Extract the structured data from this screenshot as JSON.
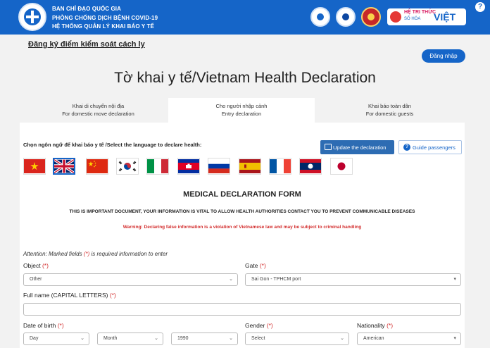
{
  "header": {
    "line1": "BAN CHỈ ĐẠO QUỐC GIA",
    "line2": "PHÒNG CHỐNG DỊCH BỆNH COVID-19",
    "line3": "HỆ THỐNG QUẢN LÝ KHAI BÁO Y TẾ",
    "brand_line1": "HỆ TRI THỨC",
    "brand_line2": "SỐ HÓA",
    "brand_line3": "VIỆT",
    "help": "?"
  },
  "top": {
    "register_link": "Đăng ký điểm kiểm soát cách ly",
    "login_button": "Đăng nhập",
    "page_title": "Tờ khai y tế/Vietnam Health Declaration"
  },
  "tabs": [
    {
      "line1": "Khai di chuyển nội địa",
      "line2": "For domestic move declaration"
    },
    {
      "line1": "Cho người nhập cảnh",
      "line2": "Entry declaration"
    },
    {
      "line1": "Khai báo toàn dân",
      "line2": "For domestic guests"
    }
  ],
  "form": {
    "language_label": "Chọn ngôn ngữ để khai báo y tế /Select the language to declare health:",
    "update_button": "Update the declaration",
    "guide_button": "Guide passengers",
    "title": "MEDICAL DECLARATION FORM",
    "important_note": "THIS IS IMPORTANT DOCUMENT, YOUR INFORMATION IS VITAL TO ALLOW HEALTH AUTHORITIES CONTACT YOU TO PREVENT COMMUNICABLE DISEASES",
    "warning": "Warning: Declaring false information is a violation of Vietnamese law and may be subject to criminal handling",
    "attention_before": "Attention: Marked fields ",
    "attention_after": " is required information to enter",
    "required_mark": "(*)",
    "object_label": "Object",
    "object_value": "Other",
    "gate_label": "Gate",
    "gate_value": "Sai Gon - TPHCM port",
    "fullname_label": "Full name (CAPITAL LETTERS)",
    "dob_label": "Date of birth",
    "dob_day": "Day",
    "dob_month": "Month",
    "dob_year": "1990",
    "gender_label": "Gender",
    "gender_value": "Select",
    "nationality_label": "Nationality",
    "nationality_value": "American"
  },
  "colors": {
    "primary": "#1565c8",
    "required": "#d32f2f"
  }
}
